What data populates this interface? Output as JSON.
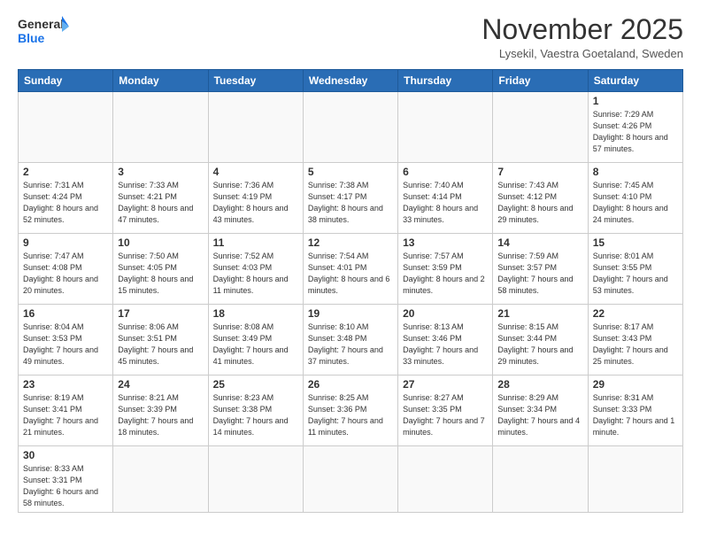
{
  "logo": {
    "text_general": "General",
    "text_blue": "Blue"
  },
  "header": {
    "month_title": "November 2025",
    "subtitle": "Lysekil, Vaestra Goetaland, Sweden"
  },
  "weekdays": [
    "Sunday",
    "Monday",
    "Tuesday",
    "Wednesday",
    "Thursday",
    "Friday",
    "Saturday"
  ],
  "weeks": [
    [
      {
        "day": "",
        "info": ""
      },
      {
        "day": "",
        "info": ""
      },
      {
        "day": "",
        "info": ""
      },
      {
        "day": "",
        "info": ""
      },
      {
        "day": "",
        "info": ""
      },
      {
        "day": "",
        "info": ""
      },
      {
        "day": "1",
        "info": "Sunrise: 7:29 AM\nSunset: 4:26 PM\nDaylight: 8 hours\nand 57 minutes."
      }
    ],
    [
      {
        "day": "2",
        "info": "Sunrise: 7:31 AM\nSunset: 4:24 PM\nDaylight: 8 hours\nand 52 minutes."
      },
      {
        "day": "3",
        "info": "Sunrise: 7:33 AM\nSunset: 4:21 PM\nDaylight: 8 hours\nand 47 minutes."
      },
      {
        "day": "4",
        "info": "Sunrise: 7:36 AM\nSunset: 4:19 PM\nDaylight: 8 hours\nand 43 minutes."
      },
      {
        "day": "5",
        "info": "Sunrise: 7:38 AM\nSunset: 4:17 PM\nDaylight: 8 hours\nand 38 minutes."
      },
      {
        "day": "6",
        "info": "Sunrise: 7:40 AM\nSunset: 4:14 PM\nDaylight: 8 hours\nand 33 minutes."
      },
      {
        "day": "7",
        "info": "Sunrise: 7:43 AM\nSunset: 4:12 PM\nDaylight: 8 hours\nand 29 minutes."
      },
      {
        "day": "8",
        "info": "Sunrise: 7:45 AM\nSunset: 4:10 PM\nDaylight: 8 hours\nand 24 minutes."
      }
    ],
    [
      {
        "day": "9",
        "info": "Sunrise: 7:47 AM\nSunset: 4:08 PM\nDaylight: 8 hours\nand 20 minutes."
      },
      {
        "day": "10",
        "info": "Sunrise: 7:50 AM\nSunset: 4:05 PM\nDaylight: 8 hours\nand 15 minutes."
      },
      {
        "day": "11",
        "info": "Sunrise: 7:52 AM\nSunset: 4:03 PM\nDaylight: 8 hours\nand 11 minutes."
      },
      {
        "day": "12",
        "info": "Sunrise: 7:54 AM\nSunset: 4:01 PM\nDaylight: 8 hours\nand 6 minutes."
      },
      {
        "day": "13",
        "info": "Sunrise: 7:57 AM\nSunset: 3:59 PM\nDaylight: 8 hours\nand 2 minutes."
      },
      {
        "day": "14",
        "info": "Sunrise: 7:59 AM\nSunset: 3:57 PM\nDaylight: 7 hours\nand 58 minutes."
      },
      {
        "day": "15",
        "info": "Sunrise: 8:01 AM\nSunset: 3:55 PM\nDaylight: 7 hours\nand 53 minutes."
      }
    ],
    [
      {
        "day": "16",
        "info": "Sunrise: 8:04 AM\nSunset: 3:53 PM\nDaylight: 7 hours\nand 49 minutes."
      },
      {
        "day": "17",
        "info": "Sunrise: 8:06 AM\nSunset: 3:51 PM\nDaylight: 7 hours\nand 45 minutes."
      },
      {
        "day": "18",
        "info": "Sunrise: 8:08 AM\nSunset: 3:49 PM\nDaylight: 7 hours\nand 41 minutes."
      },
      {
        "day": "19",
        "info": "Sunrise: 8:10 AM\nSunset: 3:48 PM\nDaylight: 7 hours\nand 37 minutes."
      },
      {
        "day": "20",
        "info": "Sunrise: 8:13 AM\nSunset: 3:46 PM\nDaylight: 7 hours\nand 33 minutes."
      },
      {
        "day": "21",
        "info": "Sunrise: 8:15 AM\nSunset: 3:44 PM\nDaylight: 7 hours\nand 29 minutes."
      },
      {
        "day": "22",
        "info": "Sunrise: 8:17 AM\nSunset: 3:43 PM\nDaylight: 7 hours\nand 25 minutes."
      }
    ],
    [
      {
        "day": "23",
        "info": "Sunrise: 8:19 AM\nSunset: 3:41 PM\nDaylight: 7 hours\nand 21 minutes."
      },
      {
        "day": "24",
        "info": "Sunrise: 8:21 AM\nSunset: 3:39 PM\nDaylight: 7 hours\nand 18 minutes."
      },
      {
        "day": "25",
        "info": "Sunrise: 8:23 AM\nSunset: 3:38 PM\nDaylight: 7 hours\nand 14 minutes."
      },
      {
        "day": "26",
        "info": "Sunrise: 8:25 AM\nSunset: 3:36 PM\nDaylight: 7 hours\nand 11 minutes."
      },
      {
        "day": "27",
        "info": "Sunrise: 8:27 AM\nSunset: 3:35 PM\nDaylight: 7 hours\nand 7 minutes."
      },
      {
        "day": "28",
        "info": "Sunrise: 8:29 AM\nSunset: 3:34 PM\nDaylight: 7 hours\nand 4 minutes."
      },
      {
        "day": "29",
        "info": "Sunrise: 8:31 AM\nSunset: 3:33 PM\nDaylight: 7 hours\nand 1 minute."
      }
    ],
    [
      {
        "day": "30",
        "info": "Sunrise: 8:33 AM\nSunset: 3:31 PM\nDaylight: 6 hours\nand 58 minutes."
      },
      {
        "day": "",
        "info": ""
      },
      {
        "day": "",
        "info": ""
      },
      {
        "day": "",
        "info": ""
      },
      {
        "day": "",
        "info": ""
      },
      {
        "day": "",
        "info": ""
      },
      {
        "day": "",
        "info": ""
      }
    ]
  ]
}
